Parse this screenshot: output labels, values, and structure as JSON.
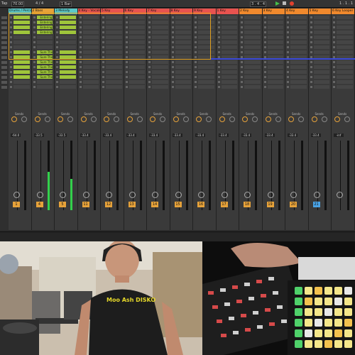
{
  "topbar": {
    "tap": "Tap",
    "tempo": "70.00",
    "timesig": "4 / 4",
    "bar": "1 Bar",
    "position": "3 . 4 . 4",
    "right_pos": "1 . 1 . 1"
  },
  "tracks": [
    {
      "name": "Drums / Percs",
      "color": "#5bc8c8"
    },
    {
      "name": "2 Bass",
      "color": "#e6a23a"
    },
    {
      "name": "3 Melody",
      "color": "#5bc8c8"
    },
    {
      "name": "4 Key - Vocals",
      "color": "#e8534f"
    },
    {
      "name": "5 Key",
      "color": "#e8534f"
    },
    {
      "name": "6 Key",
      "color": "#e8534f"
    },
    {
      "name": "7 Key",
      "color": "#e8534f"
    },
    {
      "name": "8 Key",
      "color": "#e8534f"
    },
    {
      "name": "9 Key",
      "color": "#e8534f"
    },
    {
      "name": "1 Key",
      "color": "#e8534f"
    },
    {
      "name": "2 Key",
      "color": "#f0892d"
    },
    {
      "name": "3 Key",
      "color": "#f0892d"
    },
    {
      "name": "4 Key",
      "color": "#f0892d"
    },
    {
      "name": "5 Key",
      "color": "#f0892d"
    },
    {
      "name": "6 Key Looper",
      "color": "#f0892d"
    }
  ],
  "clip_names": {
    "bass_top": [
      "Entering The H",
      "Entering The H",
      "Entering The H",
      "Entering The H"
    ],
    "bass_bottom": [
      "Sure The Sun Is",
      "Sure The Sun Is",
      "Sure The Sun Is",
      "Sure The Sun Is",
      "Sure The Sun Is",
      "Sure The Sun Is"
    ]
  },
  "mixer": {
    "sends_label": "Sends",
    "volumes": [
      "-64.0",
      "-33.5",
      "-33.5",
      "-33.4",
      "-33.4",
      "-33.4",
      "-33.4",
      "-33.4",
      "-33.4",
      "-33.4",
      "-33.4",
      "-33.4",
      "-33.4",
      "-33.4",
      "-inf"
    ],
    "track_numbers": [
      "1",
      "4",
      "5",
      "11",
      "12",
      "13",
      "14",
      "15",
      "16",
      "17",
      "18",
      "19",
      "20",
      "21"
    ],
    "meter_levels": [
      0,
      0.55,
      0.45,
      0,
      0,
      0,
      0,
      0,
      0,
      0,
      0,
      0,
      0,
      0,
      0
    ]
  },
  "colors": {
    "clip_green": "#9fc53b",
    "selection_orange": "#e0a020",
    "selection_blue": "#3a48d8",
    "meter_green": "#33d04b",
    "track_number_orange": "#e6a23a",
    "track_number_blue": "#4aa3e6"
  },
  "shirt_text": "Moo Ash DISKO"
}
